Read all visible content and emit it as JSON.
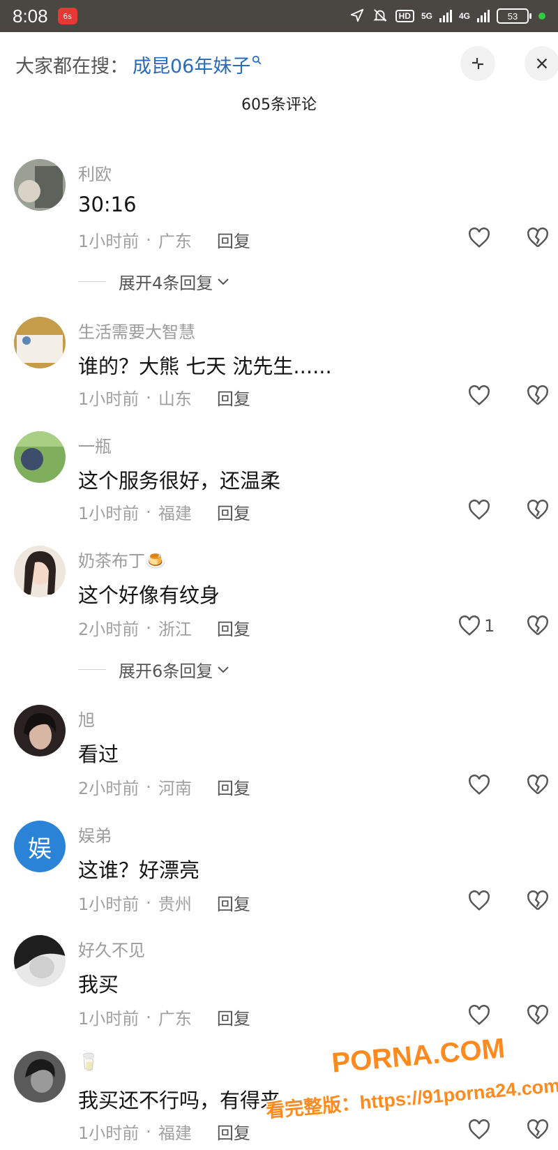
{
  "status_bar": {
    "time": "8:08",
    "app_badge": "6s",
    "hd_label": "HD",
    "net1": "5G",
    "net2": "4G",
    "battery": "53"
  },
  "search": {
    "prefix": "大家都在搜：",
    "term": "成昆06年妹子",
    "term_icon": "search-icon"
  },
  "comment_count": "605条评论",
  "reply_label": "回复",
  "comments": [
    {
      "user": "利欧",
      "text": "30:16",
      "time": "1小时前",
      "region": "广东",
      "likes": "",
      "expand": "展开4条回复",
      "avatar_color": "#8a8f86"
    },
    {
      "user": "生活需要大智慧",
      "text": "谁的？大熊 七天 沈先生......",
      "time": "1小时前",
      "region": "山东",
      "likes": "",
      "avatar_color": "#b48a3c"
    },
    {
      "user": "一瓶",
      "text": "这个服务很好，还温柔",
      "time": "1小时前",
      "region": "福建",
      "likes": "",
      "avatar_color": "#6f9a52"
    },
    {
      "user": "奶茶布丁",
      "user_emoji": "🍮",
      "text": "这个好像有纹身",
      "time": "2小时前",
      "region": "浙江",
      "likes": "1",
      "expand": "展开6条回复",
      "avatar_color": "#d9c4b8"
    },
    {
      "user": "旭",
      "text": "看过",
      "time": "2小时前",
      "region": "河南",
      "likes": "",
      "avatar_color": "#3a3030"
    },
    {
      "user": "娱弟",
      "avatar_text": "娱",
      "text": "这谁？好漂亮",
      "time": "1小时前",
      "region": "贵州",
      "likes": "",
      "avatar_color": "#2a83d6"
    },
    {
      "user": "好久不见",
      "text": "我买",
      "time": "1小时前",
      "region": "广东",
      "likes": "",
      "avatar_color": "#5b5b5b"
    },
    {
      "user": "",
      "user_emoji": "🥛",
      "text": "我买还不行吗，有得来",
      "time": "1小时前",
      "region": "福建",
      "likes": "",
      "avatar_color": "#6e6e6e"
    }
  ],
  "watermark": {
    "brand": "PORNA.COM",
    "url": "看完整版：https://91porna24.com"
  },
  "colors": {
    "status_bar": "#4a4641",
    "search_term": "#2a6bb8",
    "muted": "#a0a0a0",
    "watermark": "#ff8a1e"
  }
}
